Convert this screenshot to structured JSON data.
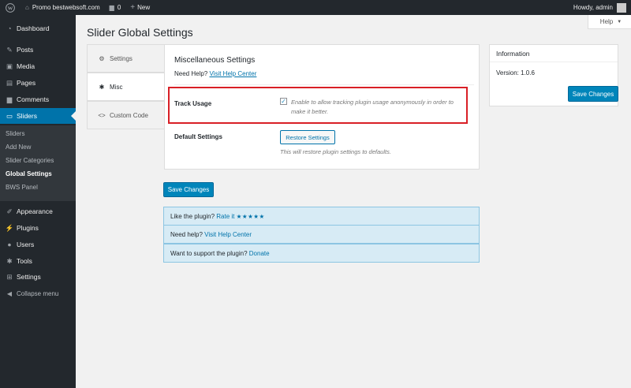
{
  "adminbar": {
    "site_name": "Promo bestwebsoft.com",
    "comments_count": "0",
    "new_label": "New",
    "howdy": "Howdy, admin"
  },
  "help_tab": {
    "label": "Help",
    "chevron": "▼"
  },
  "sidebar": {
    "items": [
      {
        "label": "Dashboard",
        "icon": "dashboard-icon"
      },
      {
        "label": "Posts",
        "icon": "pin-icon"
      },
      {
        "label": "Media",
        "icon": "media-icon"
      },
      {
        "label": "Pages",
        "icon": "pages-icon"
      },
      {
        "label": "Comments",
        "icon": "comment-icon"
      },
      {
        "label": "Sliders",
        "icon": "slider-icon",
        "active": true
      },
      {
        "label": "Appearance",
        "icon": "brush-icon"
      },
      {
        "label": "Plugins",
        "icon": "plug-icon"
      },
      {
        "label": "Users",
        "icon": "users-icon"
      },
      {
        "label": "Tools",
        "icon": "wrench-icon"
      },
      {
        "label": "Settings",
        "icon": "settings-icon"
      },
      {
        "label": "Collapse menu",
        "icon": "collapse-icon"
      }
    ],
    "submenu": [
      {
        "label": "Sliders"
      },
      {
        "label": "Add New"
      },
      {
        "label": "Slider Categories"
      },
      {
        "label": "Global Settings",
        "current": true
      },
      {
        "label": "BWS Panel"
      }
    ]
  },
  "page": {
    "title": "Slider Global Settings"
  },
  "tabs": [
    {
      "label": "Settings",
      "icon": "gear-icon"
    },
    {
      "label": "Misc",
      "icon": "wrench-icon",
      "active": true
    },
    {
      "label": "Custom Code",
      "icon": "code-icon"
    }
  ],
  "misc": {
    "title": "Miscellaneous Settings",
    "need_help_prefix": "Need Help?",
    "need_help_link": "Visit Help Center",
    "track_label": "Track Usage",
    "track_checked": true,
    "track_description": "Enable to allow tracking plugin usage anonymously in order to make it better.",
    "default_label": "Default Settings",
    "restore_button": "Restore Settings",
    "restore_description": "This will restore plugin settings to defaults."
  },
  "save_button": "Save Changes",
  "info": {
    "title": "Information",
    "version": "Version: 1.0.6",
    "save_button": "Save Changes"
  },
  "promo": {
    "rate_prefix": "Like the plugin?",
    "rate_link": "Rate it",
    "stars": "★★★★★",
    "help_prefix": "Need help?",
    "help_link": "Visit Help Center",
    "support_prefix": "Want to support the plugin?",
    "support_link": "Donate"
  },
  "colors": {
    "adminbar_bg": "#23282d",
    "accent": "#0073aa",
    "highlight_border": "#d91f26",
    "promo_bg": "#d7ebf5"
  }
}
